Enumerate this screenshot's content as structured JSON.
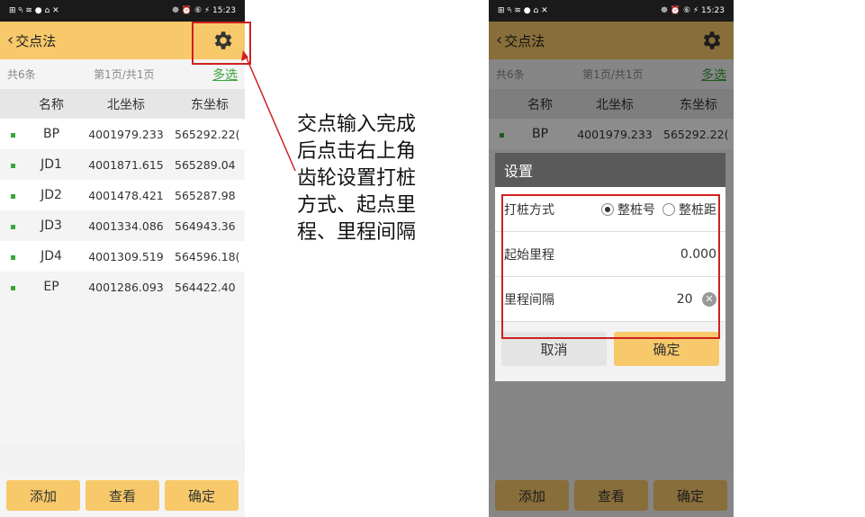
{
  "status": {
    "left": "⊞ ᵍₗ ≋ ● ⌂ ✕",
    "right": "☸ ⏰ ⑥ ⚡ 15:23"
  },
  "app": {
    "title": "交点法"
  },
  "info": {
    "total": "共6条",
    "page": "第1页/共1页",
    "multi_select": "多选"
  },
  "table": {
    "headers": [
      "名称",
      "北坐标",
      "东坐标"
    ],
    "rows": [
      {
        "name": "BP",
        "north": "4001979.233",
        "east": "565292.22("
      },
      {
        "name": "JD1",
        "north": "4001871.615",
        "east": "565289.04"
      },
      {
        "name": "JD2",
        "north": "4001478.421",
        "east": "565287.98"
      },
      {
        "name": "JD3",
        "north": "4001334.086",
        "east": "564943.36"
      },
      {
        "name": "JD4",
        "north": "4001309.519",
        "east": "564596.18("
      },
      {
        "name": "EP",
        "north": "4001286.093",
        "east": "564422.40"
      }
    ]
  },
  "footer": {
    "add": "添加",
    "view": "查看",
    "confirm": "确定"
  },
  "dialog": {
    "title": "设置",
    "pile_label": "打桩方式",
    "pile_opt1": "整桩号",
    "pile_opt2": "整桩距",
    "start_label": "起始里程",
    "start_value": "0.000",
    "interval_label": "里程间隔",
    "interval_value": "20",
    "cancel": "取消",
    "ok": "确定"
  },
  "annotation": {
    "lines": [
      "交点输入完成",
      "后点击右上角",
      "齿轮设置打桩",
      "方式、起点里",
      "程、里程间隔"
    ]
  },
  "colors": {
    "accent": "#f7c96a",
    "highlight": "#d02020",
    "green": "#3aa53a"
  }
}
